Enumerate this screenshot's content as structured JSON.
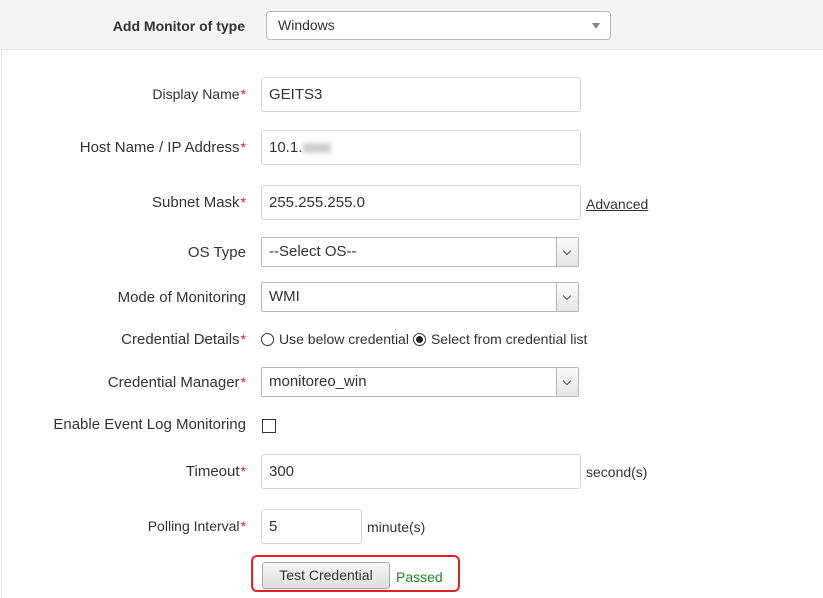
{
  "header": {
    "label": "Add Monitor of type",
    "monitor_type": "Windows"
  },
  "form": {
    "display_name": {
      "label": "Display Name",
      "value": "GEITS3"
    },
    "host": {
      "label": "Host Name / IP Address",
      "value": "10.1."
    },
    "subnet": {
      "label": "Subnet Mask",
      "value": "255.255.255.0",
      "advanced_link": "Advanced"
    },
    "os_type": {
      "label": "OS Type",
      "value": "--Select OS--"
    },
    "mode": {
      "label": "Mode of Monitoring",
      "value": "WMI"
    },
    "credential_details": {
      "label": "Credential Details",
      "option_below": "Use below credential",
      "option_list": "Select from credential list",
      "selected": "Select from credential list"
    },
    "credential_manager": {
      "label": "Credential Manager",
      "value": "monitoreo_win"
    },
    "event_log": {
      "label": "Enable Event Log Monitoring",
      "checked": false
    },
    "timeout": {
      "label": "Timeout",
      "value": "300",
      "unit": "second(s)"
    },
    "polling": {
      "label": "Polling Interval",
      "value": "5",
      "unit": "minute(s)"
    },
    "required_marker": "*"
  },
  "actions": {
    "test_credential": "Test Credential",
    "status": "Passed"
  },
  "colors": {
    "required": "#d61d1d",
    "status_passed": "#1f8a1f",
    "highlight": "#e02424"
  }
}
